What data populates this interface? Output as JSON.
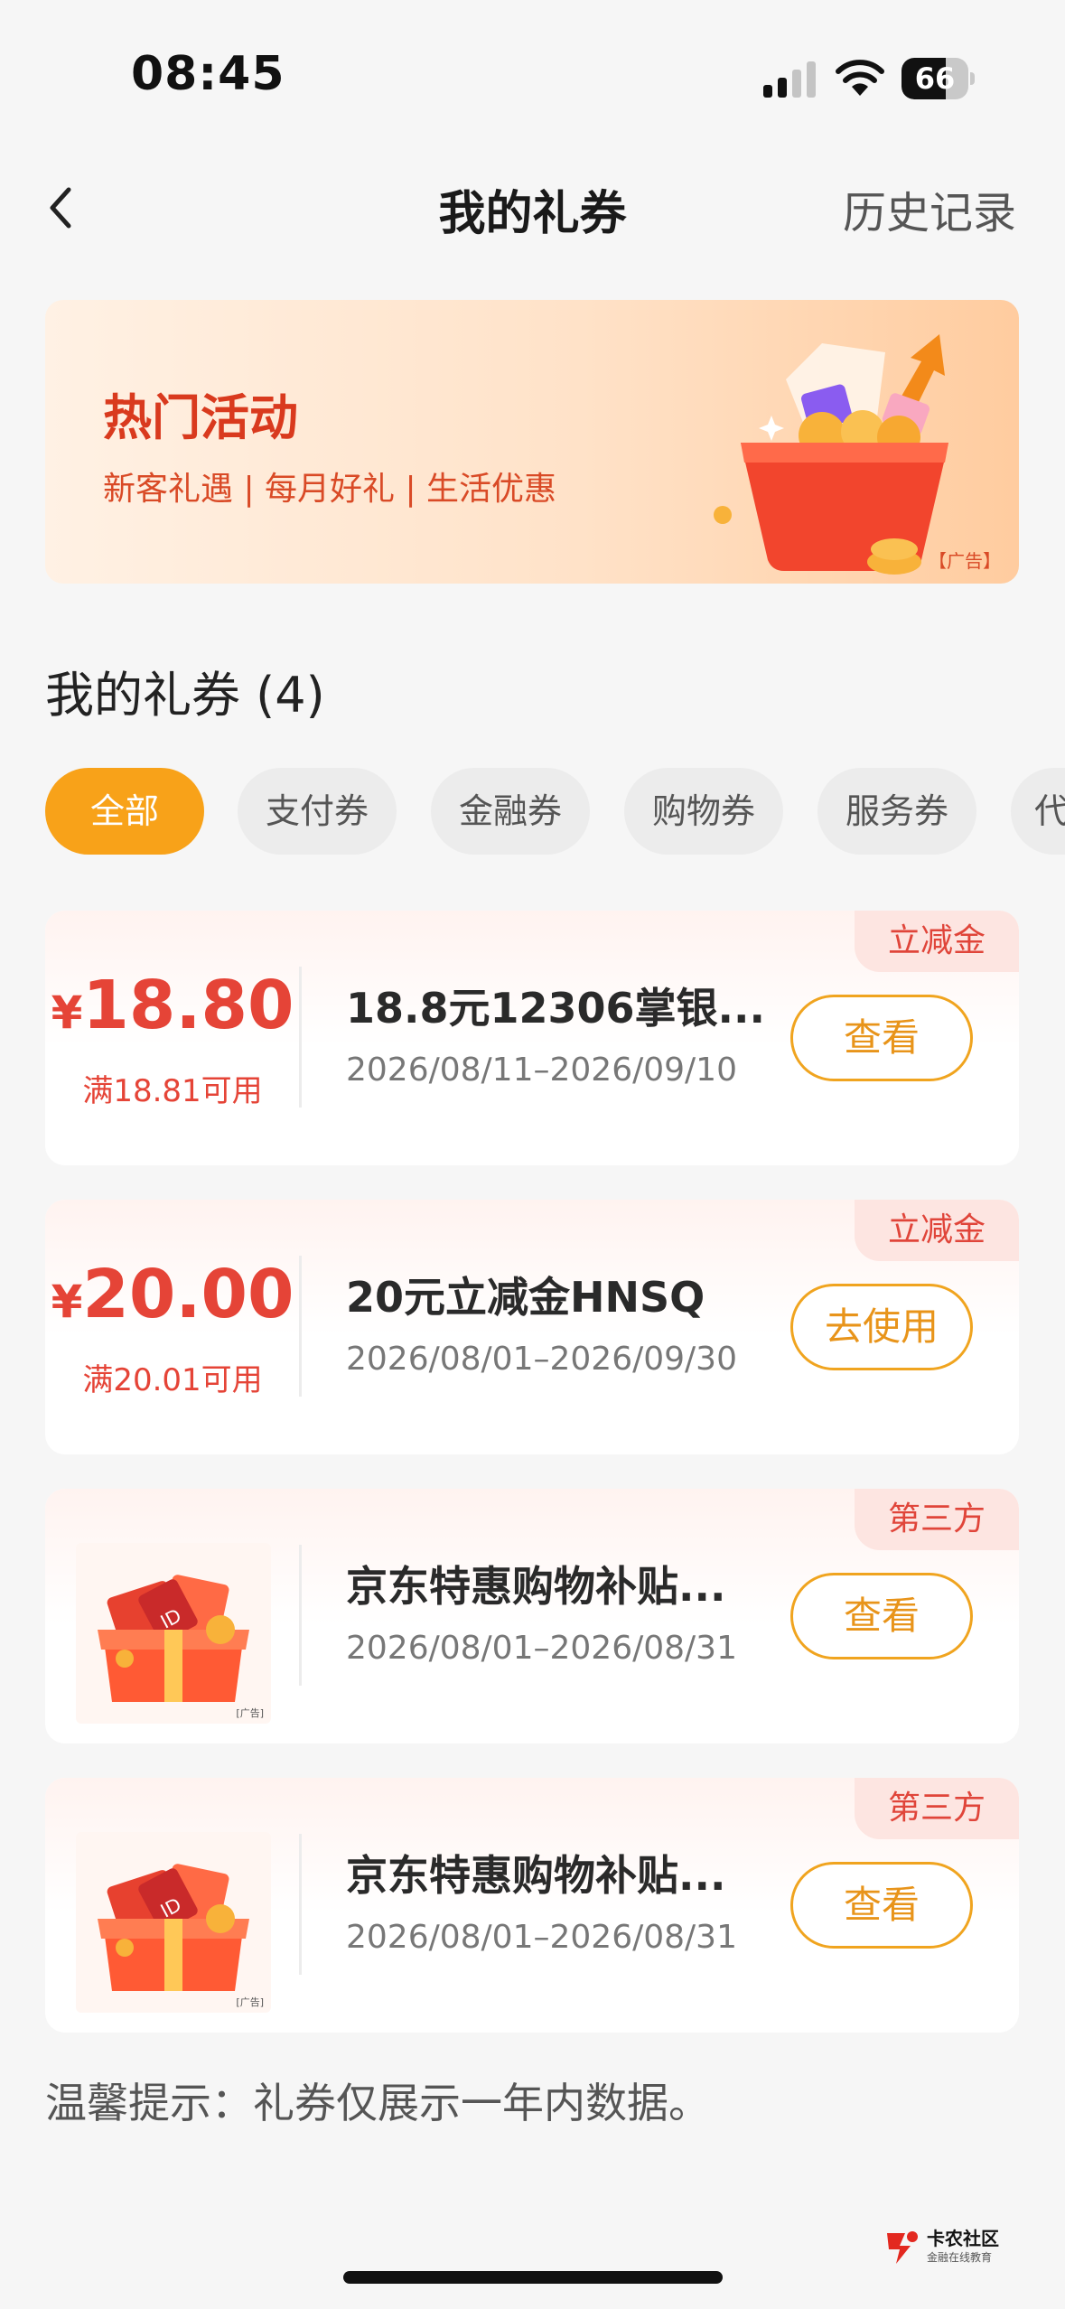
{
  "status_bar": {
    "time": "08:45",
    "battery_level": 66,
    "battery_label": "66"
  },
  "nav": {
    "title": "我的礼券",
    "history": "历史记录"
  },
  "banner": {
    "title": "热门活动",
    "subtitle": "新客礼遇 | 每月好礼 | 生活优惠",
    "ad_tag": "【广告】"
  },
  "section": {
    "title": "我的礼券 (4)"
  },
  "tabs": [
    {
      "label": "全部",
      "active": true
    },
    {
      "label": "支付券",
      "active": false
    },
    {
      "label": "金融券",
      "active": false
    },
    {
      "label": "购物券",
      "active": false
    },
    {
      "label": "服务券",
      "active": false
    },
    {
      "label": "代",
      "active": false
    }
  ],
  "coupons": [
    {
      "tag": "立减金",
      "currency": "¥",
      "amount": "18.80",
      "condition": "满18.81可用",
      "name": "18.8元12306掌银...",
      "date_range": "2026/08/11–2026/09/10",
      "button": "查看"
    },
    {
      "tag": "立减金",
      "currency": "¥",
      "amount": "20.00",
      "condition": "满20.01可用",
      "name": "20元立减金HNSQ",
      "date_range": "2026/08/01–2026/09/30",
      "button": "去使用"
    },
    {
      "tag": "第三方",
      "image": "gift-box-icon",
      "image_ad": "[广告]",
      "name": "京东特惠购物补贴...",
      "date_range": "2026/08/01–2026/08/31",
      "button": "查看"
    },
    {
      "tag": "第三方",
      "image": "gift-box-icon",
      "image_ad": "[广告]",
      "name": "京东特惠购物补贴...",
      "date_range": "2026/08/01–2026/08/31",
      "button": "查看"
    }
  ],
  "tip": "温馨提示：礼券仅展示一年内数据。",
  "watermark": {
    "text": "卡农社区",
    "sub": "金融在线教育"
  },
  "colors": {
    "accent": "#f8a219",
    "red": "#e54437",
    "tag_bg": "#fde5e1",
    "button_border": "#f0a41f"
  }
}
